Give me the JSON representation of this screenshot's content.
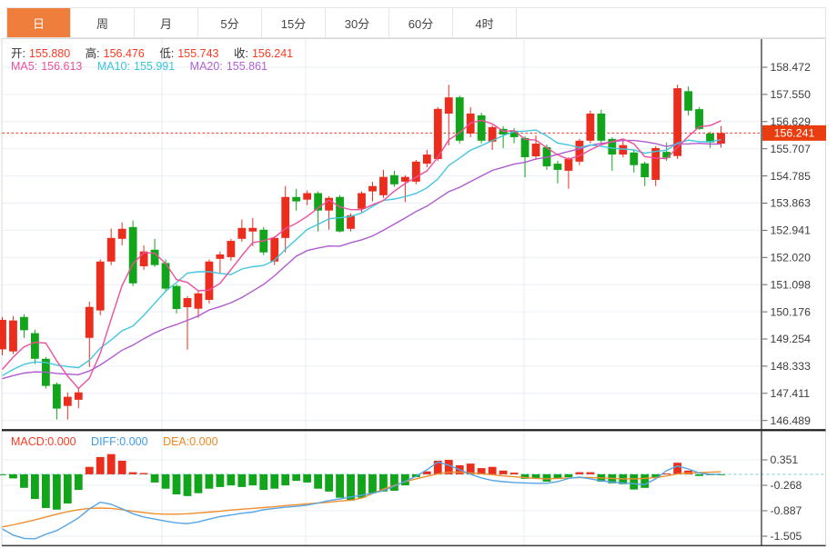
{
  "tabs": [
    {
      "id": "day",
      "label": "日",
      "selected": true
    },
    {
      "id": "week",
      "label": "周",
      "selected": false
    },
    {
      "id": "month",
      "label": "月",
      "selected": false
    },
    {
      "id": "5min",
      "label": "5分",
      "selected": false
    },
    {
      "id": "15min",
      "label": "15分",
      "selected": false
    },
    {
      "id": "30min",
      "label": "30分",
      "selected": false
    },
    {
      "id": "60min",
      "label": "60分",
      "selected": false
    },
    {
      "id": "4hour",
      "label": "4时",
      "selected": false
    }
  ],
  "quote": {
    "open_label": "开:",
    "open": "155.880",
    "high_label": "高:",
    "high": "156.476",
    "low_label": "低:",
    "low": "155.743",
    "close_label": "收:",
    "close": "156.241"
  },
  "ma_info": {
    "ma5_label": "MA5:",
    "ma5": "156.613",
    "ma10_label": "MA10:",
    "ma10": "155.991",
    "ma20_label": "MA20:",
    "ma20": "155.861"
  },
  "macd_info": {
    "macd_label": "MACD:",
    "macd": "0.000",
    "diff_label": "DIFF:",
    "diff": "0.000",
    "dea_label": "DEA:",
    "dea": "0.000"
  },
  "last_price": "156.241",
  "colors": {
    "up": "#ea2d1d",
    "down": "#12a41b",
    "ma5": "#ed4f9d",
    "ma10": "#43c6e0",
    "ma20": "#b05ad2",
    "diff": "#55a4e6",
    "dea": "#ef8e2d",
    "grid": "#eaeff6",
    "vgrid": "#e4ebf3",
    "dotted_red": "#f3321c",
    "macd_zero": "#8fd9e8",
    "badge_bg": "#e93c0f",
    "badge_text": "#ffffff",
    "axis_text": "#3c3c3c",
    "axis_line": "#333333",
    "separator": "#1a1a1a",
    "panel_border": "#dadada",
    "tab_accent": "#ef7d3b"
  },
  "chart_data": {
    "type": "candlestick+macd",
    "title": "",
    "price_axis_ticks": [
      "158.472",
      "157.550",
      "156.629",
      "155.707",
      "154.785",
      "153.863",
      "152.941",
      "152.020",
      "151.098",
      "150.176",
      "149.254",
      "148.333",
      "147.411",
      "146.489"
    ],
    "macd_axis_ticks": [
      "0.351",
      "-0.268",
      "-0.887",
      "-1.505"
    ],
    "current_price": 156.241,
    "ma_periods": [
      5,
      10,
      20
    ],
    "ma_prehistory": 147.8,
    "candles": [
      [
        148.9,
        150.0,
        148.7,
        149.9
      ],
      [
        148.83,
        150.03,
        148.74,
        149.88
      ],
      [
        150.0,
        150.09,
        149.29,
        149.55
      ],
      [
        149.45,
        149.57,
        148.4,
        148.58
      ],
      [
        148.58,
        148.64,
        147.57,
        147.66
      ],
      [
        147.72,
        147.78,
        146.52,
        146.89
      ],
      [
        146.98,
        147.44,
        146.52,
        147.29
      ],
      [
        147.19,
        147.6,
        146.9,
        147.44
      ],
      [
        149.29,
        150.52,
        148.3,
        150.34
      ],
      [
        150.22,
        151.95,
        150.06,
        151.88
      ],
      [
        151.88,
        153.0,
        151.76,
        152.68
      ],
      [
        152.65,
        153.21,
        152.43,
        152.99
      ],
      [
        153.05,
        153.27,
        151.05,
        151.14
      ],
      [
        151.72,
        152.43,
        151.6,
        152.22
      ],
      [
        152.28,
        152.65,
        151.7,
        151.76
      ],
      [
        151.83,
        151.95,
        150.89,
        150.96
      ],
      [
        151.05,
        151.11,
        150.12,
        150.27
      ],
      [
        150.33,
        150.71,
        148.89,
        150.64
      ],
      [
        150.28,
        150.89,
        149.97,
        150.8
      ],
      [
        150.58,
        151.95,
        150.46,
        151.88
      ],
      [
        151.97,
        152.22,
        151.48,
        152.12
      ],
      [
        152.03,
        152.65,
        151.91,
        152.58
      ],
      [
        152.65,
        153.3,
        152.55,
        153.02
      ],
      [
        152.9,
        153.36,
        152.4,
        153.02
      ],
      [
        152.96,
        153.05,
        152.1,
        152.19
      ],
      [
        151.88,
        152.74,
        151.76,
        152.68
      ],
      [
        152.68,
        154.44,
        152.19,
        154.07
      ],
      [
        154.07,
        154.35,
        153.61,
        153.92
      ],
      [
        153.98,
        154.29,
        153.79,
        154.2
      ],
      [
        154.2,
        154.26,
        152.9,
        153.61
      ],
      [
        153.61,
        154.1,
        152.96,
        154.04
      ],
      [
        154.07,
        154.13,
        152.87,
        152.9
      ],
      [
        152.99,
        153.51,
        152.9,
        153.45
      ],
      [
        153.67,
        154.26,
        153.55,
        154.2
      ],
      [
        154.26,
        154.59,
        153.92,
        154.44
      ],
      [
        154.13,
        154.99,
        154.04,
        154.75
      ],
      [
        154.81,
        154.96,
        154.41,
        154.5
      ],
      [
        154.59,
        154.81,
        153.9,
        154.75
      ],
      [
        154.59,
        155.33,
        154.5,
        155.27
      ],
      [
        155.2,
        155.67,
        155.08,
        155.51
      ],
      [
        155.36,
        157.12,
        155.3,
        157.06
      ],
      [
        156.9,
        157.88,
        155.82,
        157.45
      ],
      [
        157.45,
        157.51,
        155.89,
        155.98
      ],
      [
        156.22,
        157.12,
        156.1,
        156.9
      ],
      [
        156.84,
        156.93,
        155.89,
        155.98
      ],
      [
        155.95,
        156.5,
        155.67,
        156.44
      ],
      [
        156.38,
        156.47,
        155.73,
        156.19
      ],
      [
        156.32,
        156.41,
        155.89,
        156.1
      ],
      [
        156.07,
        156.13,
        154.74,
        155.42
      ],
      [
        155.45,
        156.16,
        155.33,
        155.88
      ],
      [
        155.76,
        155.85,
        154.99,
        155.11
      ],
      [
        155.2,
        155.3,
        154.53,
        154.99
      ],
      [
        154.96,
        155.42,
        154.35,
        155.36
      ],
      [
        155.27,
        156.04,
        155.15,
        155.98
      ],
      [
        155.98,
        157.0,
        155.89,
        156.9
      ],
      [
        156.9,
        157.03,
        155.89,
        155.98
      ],
      [
        156.04,
        156.1,
        154.96,
        155.51
      ],
      [
        155.51,
        156.01,
        155.42,
        155.83
      ],
      [
        155.58,
        155.67,
        154.9,
        155.15
      ],
      [
        155.21,
        155.27,
        154.44,
        154.74
      ],
      [
        154.65,
        155.79,
        154.44,
        155.73
      ],
      [
        155.6,
        155.92,
        155.3,
        155.4
      ],
      [
        155.46,
        157.88,
        155.36,
        157.76
      ],
      [
        157.66,
        157.82,
        156.84,
        157.0
      ],
      [
        157.05,
        157.12,
        156.35,
        156.38
      ],
      [
        156.22,
        156.29,
        155.73,
        155.92
      ],
      [
        155.88,
        156.476,
        155.743,
        156.241
      ]
    ],
    "macd_hist": [
      -0.02,
      -0.1,
      -0.33,
      -0.6,
      -0.82,
      -0.86,
      -0.71,
      -0.38,
      0.18,
      0.42,
      0.49,
      0.33,
      0.05,
      0.03,
      -0.2,
      -0.35,
      -0.49,
      -0.53,
      -0.46,
      -0.35,
      -0.31,
      -0.27,
      -0.31,
      -0.27,
      -0.38,
      -0.35,
      -0.27,
      -0.16,
      -0.2,
      -0.35,
      -0.42,
      -0.57,
      -0.64,
      -0.57,
      -0.46,
      -0.42,
      -0.4,
      -0.27,
      -0.07,
      0.07,
      0.33,
      0.35,
      0.22,
      0.26,
      0.15,
      0.18,
      0.09,
      0.04,
      -0.11,
      -0.11,
      -0.18,
      -0.11,
      -0.07,
      0.05,
      0.05,
      -0.18,
      -0.22,
      -0.24,
      -0.37,
      -0.33,
      -0.09,
      0.02,
      0.28,
      0.09,
      -0.04,
      -0.02,
      -0.02
    ],
    "diff_line": [
      -1.33,
      -1.48,
      -1.56,
      -1.57,
      -1.46,
      -1.37,
      -1.22,
      -1.06,
      -0.84,
      -0.68,
      -0.73,
      -0.84,
      -0.96,
      -1.04,
      -1.09,
      -1.14,
      -1.18,
      -1.2,
      -1.16,
      -1.09,
      -1.03,
      -0.99,
      -0.95,
      -0.92,
      -0.86,
      -0.83,
      -0.8,
      -0.78,
      -0.75,
      -0.7,
      -0.64,
      -0.6,
      -0.55,
      -0.51,
      -0.46,
      -0.4,
      -0.29,
      -0.17,
      -0.05,
      0.11,
      0.3,
      0.22,
      0.11,
      0.0,
      -0.09,
      -0.15,
      -0.18,
      -0.2,
      -0.21,
      -0.22,
      -0.22,
      -0.18,
      -0.1,
      -0.07,
      -0.11,
      -0.16,
      -0.19,
      -0.21,
      -0.23,
      -0.25,
      -0.11,
      0.09,
      0.2,
      0.13,
      0.03,
      0.0,
      0.0
    ],
    "dea_line": [
      -1.28,
      -1.23,
      -1.17,
      -1.11,
      -1.04,
      -0.97,
      -0.91,
      -0.86,
      -0.83,
      -0.82,
      -0.83,
      -0.86,
      -0.9,
      -0.93,
      -0.96,
      -0.97,
      -0.97,
      -0.96,
      -0.94,
      -0.92,
      -0.9,
      -0.87,
      -0.85,
      -0.83,
      -0.81,
      -0.79,
      -0.76,
      -0.74,
      -0.72,
      -0.7,
      -0.68,
      -0.65,
      -0.63,
      -0.58,
      -0.47,
      -0.36,
      -0.27,
      -0.18,
      -0.11,
      -0.05,
      0.01,
      0.05,
      0.05,
      0.03,
      0.01,
      -0.01,
      -0.04,
      -0.06,
      -0.08,
      -0.1,
      -0.11,
      -0.1,
      -0.09,
      -0.08,
      -0.08,
      -0.09,
      -0.1,
      -0.11,
      -0.11,
      -0.1,
      -0.08,
      -0.04,
      0.01,
      0.03,
      0.04,
      0.05,
      0.06
    ],
    "vertical_gridlines_x": [
      178,
      336,
      576
    ],
    "legend_position": "top-left",
    "grid": true
  }
}
